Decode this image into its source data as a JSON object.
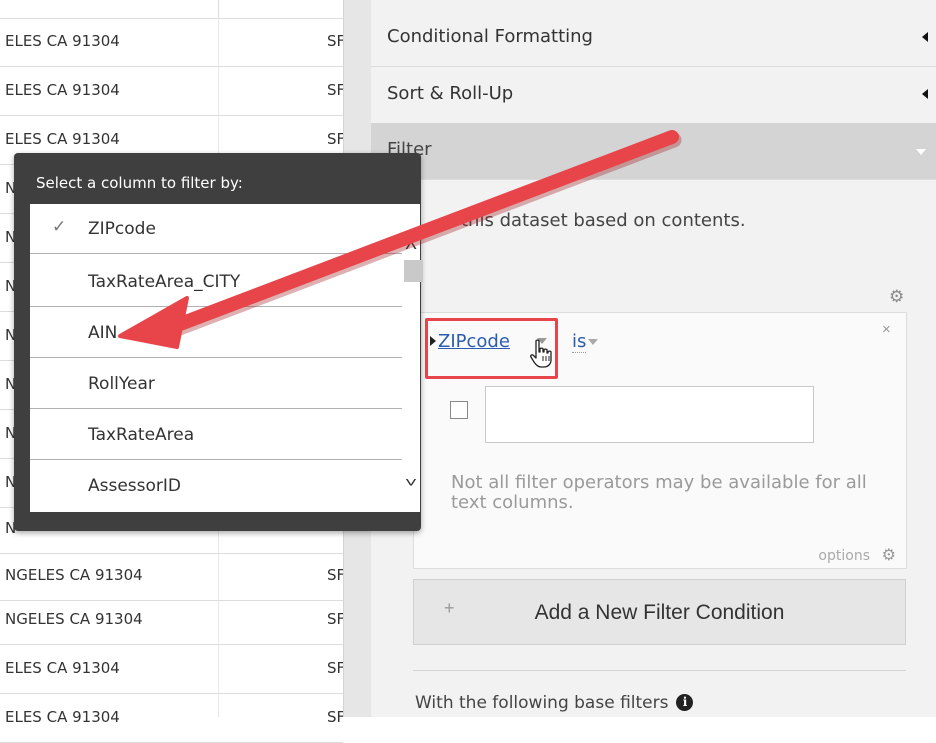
{
  "table": {
    "rows": [
      {
        "c1": "ELES CA 91304",
        "c2": "SF"
      },
      {
        "c1": "ELES CA 91304",
        "c2": "SF"
      },
      {
        "c1": "ELES CA 91304",
        "c2": "SF"
      },
      {
        "c1": "N",
        "c2": ""
      },
      {
        "c1": "N",
        "c2": ""
      },
      {
        "c1": "N",
        "c2": ""
      },
      {
        "c1": "N",
        "c2": ""
      },
      {
        "c1": "N",
        "c2": ""
      },
      {
        "c1": "N",
        "c2": ""
      },
      {
        "c1": "N",
        "c2": ""
      },
      {
        "c1": "N",
        "c2": ""
      },
      {
        "c1": "NGELES CA 91304",
        "c2": "SF"
      },
      {
        "c1": "NGELES CA 91304",
        "c2": "SF"
      },
      {
        "c1": "ELES CA 91304",
        "c2": "SF"
      },
      {
        "c1": "ELES CA 91304",
        "c2": "SF"
      }
    ]
  },
  "sidebar": {
    "sections": [
      {
        "label": "Conditional Formatting"
      },
      {
        "label": "Sort & Roll-Up"
      },
      {
        "label": "Filter"
      }
    ],
    "filter_description": "this dataset based on contents.",
    "condition": {
      "column": "ZIPcode",
      "operator": "is",
      "value": "",
      "note": "Not all filter operators may be available for all text columns.",
      "options_label": "options"
    },
    "add_button_label": "Add a New Filter Condition",
    "base_filters_label": "With the following base filters"
  },
  "popup": {
    "title": "Select a column to filter by:",
    "items": [
      {
        "label": "ZIPcode",
        "check": "✓"
      },
      {
        "label": "TaxRateArea_CITY",
        "check": ""
      },
      {
        "label": "AIN",
        "check": ""
      },
      {
        "label": "RollYear",
        "check": ""
      },
      {
        "label": "TaxRateArea",
        "check": ""
      },
      {
        "label": "AssessorID",
        "check": ""
      }
    ]
  },
  "colors": {
    "annotation_red": "#e8454a",
    "link_blue": "#2a5db0",
    "popup_bg": "#3f3f3f",
    "panel_bg": "#f2f2f2"
  }
}
